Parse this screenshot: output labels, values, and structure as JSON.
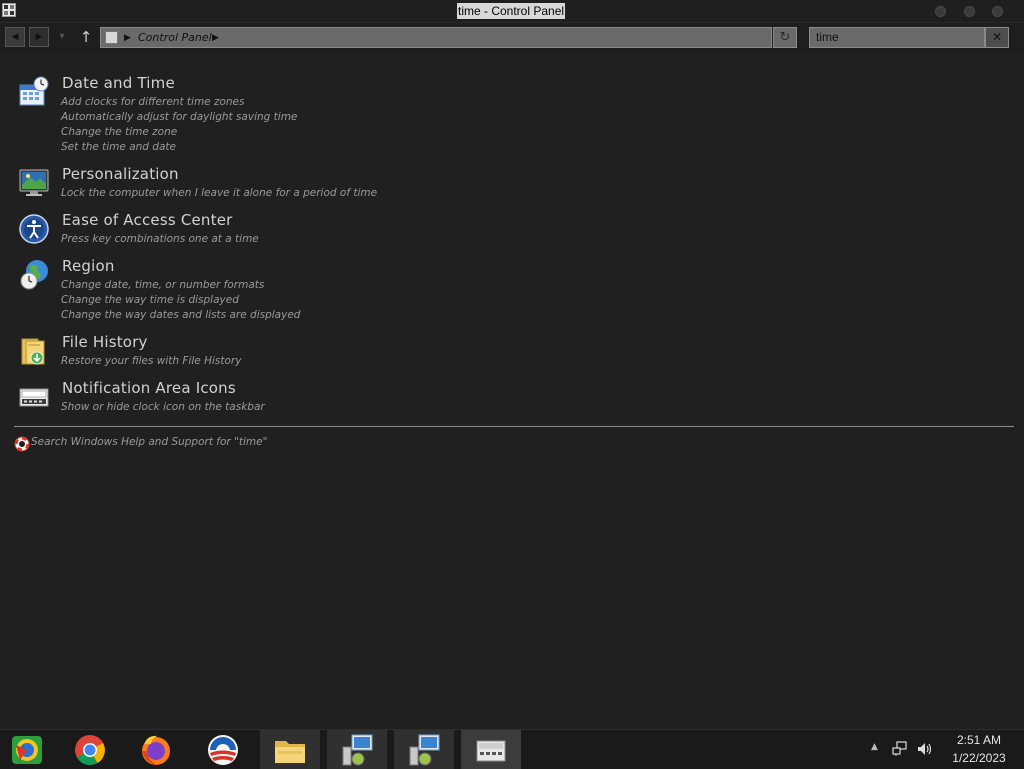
{
  "window": {
    "title": "time - Control Panel"
  },
  "navigation": {
    "breadcrumb": [
      "Control Panel"
    ],
    "search_value": "time"
  },
  "results": [
    {
      "title": "Date and Time",
      "icon": "calendar-clock-icon",
      "links": [
        "Add clocks for different time zones",
        "Automatically adjust for daylight saving time",
        "Change the time zone",
        "Set the time and date"
      ]
    },
    {
      "title": "Personalization",
      "icon": "monitor-icon",
      "links": [
        "Lock the computer when I leave it alone for a period of time"
      ]
    },
    {
      "title": "Ease of Access Center",
      "icon": "accessibility-icon",
      "links": [
        "Press key combinations one at a time"
      ]
    },
    {
      "title": "Region",
      "icon": "globe-clock-icon",
      "links": [
        "Change date, time, or number formats",
        "Change the way time is displayed",
        "Change the way dates and lists are displayed"
      ]
    },
    {
      "title": "File History",
      "icon": "folder-history-icon",
      "links": [
        "Restore your files with File History"
      ]
    },
    {
      "title": "Notification Area Icons",
      "icon": "notification-tray-icon",
      "links": [
        "Show or hide clock icon on the taskbar"
      ]
    }
  ],
  "help": {
    "text": "Search Windows Help and Support for \"time\""
  },
  "taskbar": {
    "apps": [
      "start-icon",
      "chrome-icon",
      "firefox-icon",
      "obama-logo-icon",
      "file-explorer-icon",
      "control-panel-icon",
      "control-panel-icon",
      "keyboard-app-icon"
    ],
    "clock_time": "2:51 AM",
    "clock_date": "1/22/2023"
  }
}
